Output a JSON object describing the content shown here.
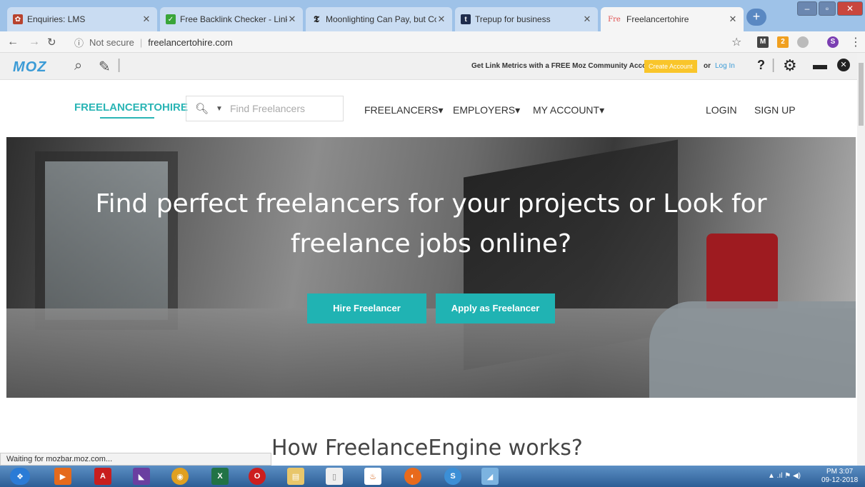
{
  "browser": {
    "tabs": [
      {
        "label": "Enquiries: LMS",
        "favicon": "lms-favicon",
        "active": false
      },
      {
        "label": "Free Backlink Checker - Link Bu",
        "favicon": "check-favicon",
        "active": false
      },
      {
        "label": "Moonlighting Can Pay, but Con",
        "favicon": "nyt-favicon",
        "active": false
      },
      {
        "label": "Trepup for business",
        "favicon": "trepup-favicon",
        "active": false
      },
      {
        "label": "Freelancertohire",
        "favicon": "fre-favicon",
        "active": true
      }
    ],
    "new_tab": "+",
    "address": {
      "security": "Not secure",
      "url": "freelancertohire.com"
    }
  },
  "mozbar": {
    "logo": "MOZ",
    "promo": "Get Link Metrics with a FREE Moz Community Account",
    "create_account": "Create Account",
    "or": "or",
    "login": "Log In",
    "help": "?"
  },
  "site": {
    "logo": "FREELANCERTOHIRE",
    "search_placeholder": "Find Freelancers",
    "nav": {
      "freelancers": "FREELANCERS▾",
      "employers": "EMPLOYERS▾",
      "my_account": "MY ACCOUNT▾",
      "login": "LOGIN",
      "signup": "SIGN UP"
    },
    "hero": {
      "title": "Find perfect freelancers for your projects or Look for freelance jobs online?",
      "hire_button": "Hire Freelancer",
      "apply_button": "Apply as Freelancer"
    },
    "how_title": "How FreelanceEngine works?"
  },
  "status_text": "Waiting for mozbar.moz.com...",
  "taskbar": {
    "time": "PM 3:07",
    "date": "09-12-2018"
  },
  "colors": {
    "accent": "#20b3b3",
    "moz_blue": "#3b9bd6",
    "moz_yellow": "#f9c52a"
  }
}
